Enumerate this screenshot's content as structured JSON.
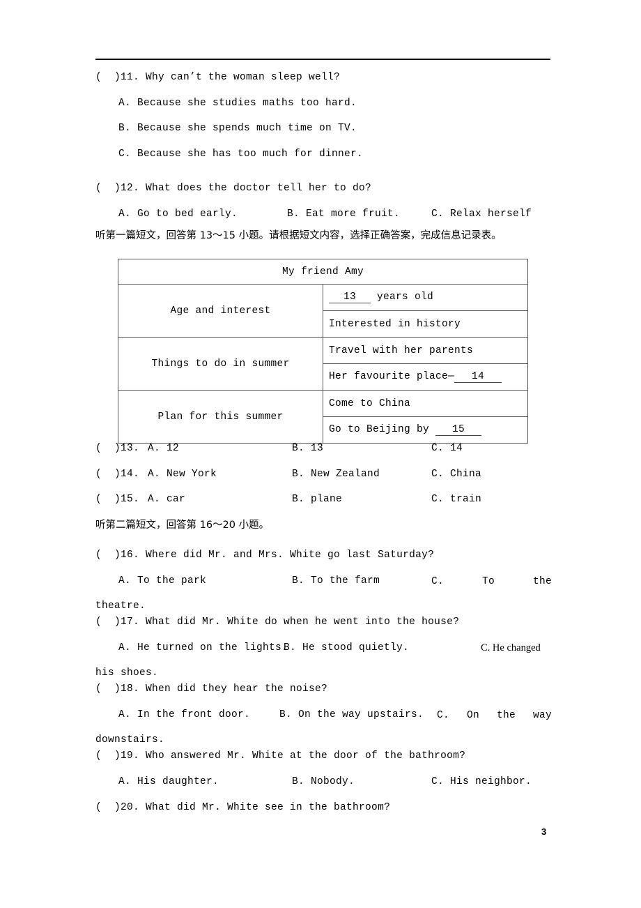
{
  "page": {
    "number": "3",
    "header_rule": true
  },
  "questions": [
    {
      "id": "q11",
      "marker": "(  )11.",
      "stem": "(  )11. Why can’t the woman sleep well?",
      "layout": "stacked",
      "options": [
        "A. Because she studies maths too hard.",
        "B. Because she spends much time on TV.",
        "C. Because she has too much for dinner."
      ]
    },
    {
      "id": "q12",
      "marker": "(  )12.",
      "stem": "(  )12. What does the doctor tell her to do?",
      "layout": "inline",
      "options": [
        "A. Go to bed early.",
        "B. Eat more fruit.",
        "C. Relax herself"
      ]
    }
  ],
  "instruction_1": "听第一篇短文，回答第 13～15 小题。请根据短文内容，选择正确答案，完成信息记录表。",
  "table": {
    "title": "My friend Amy",
    "rows": [
      {
        "label": "Age and interest",
        "cells": [
          {
            "pre": "",
            "blank": "13",
            "post": " years old"
          },
          {
            "text": "Interested in history",
            "mark_after": "hist"
          }
        ]
      },
      {
        "label": "Things to do in summer",
        "cells": [
          {
            "text": "Travel with her parents"
          },
          {
            "pre": "Her favourite place—",
            "blank": "14",
            "post": ""
          }
        ]
      },
      {
        "label": "Plan for this summer",
        "cells": [
          {
            "text": "Come to China"
          },
          {
            "pre": "Go to Beijing by ",
            "blank": "15",
            "post": ""
          }
        ]
      }
    ]
  },
  "questions_13_15": [
    {
      "id": "q13",
      "stem": "(  )13.",
      "a": "A. 12",
      "b": "B. 13",
      "c": "C. 14"
    },
    {
      "id": "q14",
      "stem": "(  )14.",
      "a": "A. New York",
      "b": "B. New Zealand",
      "c": "C. China"
    },
    {
      "id": "q15",
      "stem": "(  )15.",
      "a": "A. car",
      "b": "B. plane",
      "c": "C. train"
    }
  ],
  "instruction_2": "听第二篇短文，回答第 16～20 小题。",
  "questions_16_20": [
    {
      "id": "q16",
      "stem": "(  )16. Where did Mr. and Mrs. White go last Saturday?",
      "a": "A. To the park",
      "b": "B. To the farm",
      "c_parts": [
        "C.",
        "To",
        "the"
      ],
      "c_wrap": "theatre."
    },
    {
      "id": "q17",
      "stem": "(  )17. What did Mr. White do when he went into the house?",
      "a": "A. He turned on the lights.",
      "b": "B. He stood quietly.",
      "c": "C. He changed",
      "c_wrap": "his shoes."
    },
    {
      "id": "q18",
      "stem": "(  )18. When did they hear the noise?",
      "a": "A. In the front door.",
      "b": "B. On the way upstairs.",
      "c_parts": [
        "C.",
        "On",
        "the",
        "way"
      ],
      "c_wrap": "downstairs."
    },
    {
      "id": "q19",
      "stem": "(  )19. Who answered Mr. White at the door of the bathroom?",
      "a": "A. His daughter.",
      "b": "B. Nobody.",
      "c": "C. His neighbor."
    },
    {
      "id": "q20",
      "stem": "(  )20. What did Mr. White see in the bathroom?"
    }
  ]
}
